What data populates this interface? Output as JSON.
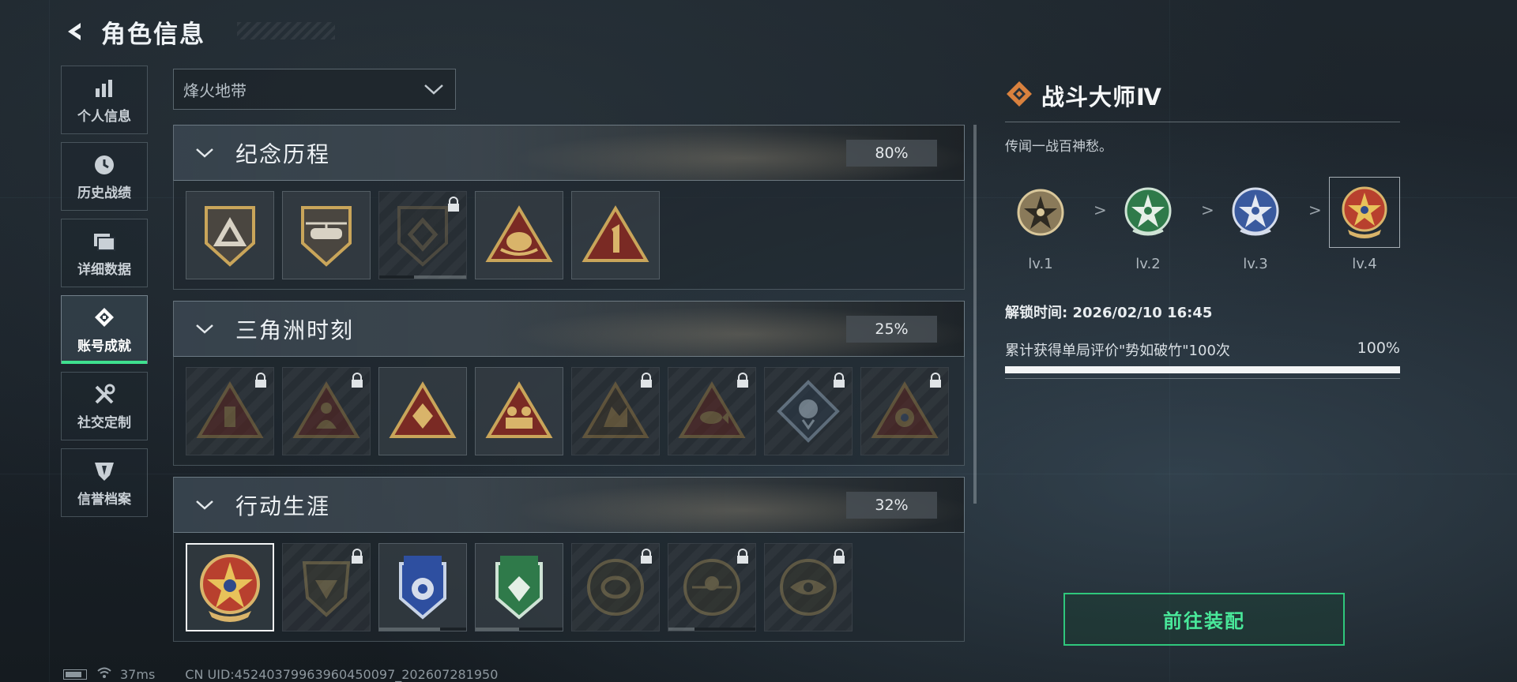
{
  "header": {
    "title": "角色信息"
  },
  "sidebar": {
    "items": [
      {
        "label": "个人信息",
        "icon": "bar-chart-icon",
        "active": false
      },
      {
        "label": "历史战绩",
        "icon": "clock-icon",
        "active": false
      },
      {
        "label": "详细数据",
        "icon": "folder-icon",
        "active": false
      },
      {
        "label": "账号成就",
        "icon": "achievement-icon",
        "active": true
      },
      {
        "label": "社交定制",
        "icon": "tools-icon",
        "active": false
      },
      {
        "label": "信誉档案",
        "icon": "shield-icon",
        "active": false
      }
    ]
  },
  "mode_select": {
    "value": "烽火地带"
  },
  "categories": [
    {
      "name": "纪念历程",
      "percent": "80%",
      "badges": [
        {
          "icon": "triangle-shield-badge",
          "locked": false
        },
        {
          "icon": "helicopter-shield-badge",
          "locked": false
        },
        {
          "icon": "emblem-shield-badge",
          "locked": true
        },
        {
          "icon": "hand-triangle-badge",
          "locked": false
        },
        {
          "icon": "number-one-triangle-badge",
          "locked": false
        }
      ]
    },
    {
      "name": "三角洲时刻",
      "percent": "25%",
      "badges": [
        {
          "icon": "bottle-triangle-badge",
          "locked": true
        },
        {
          "icon": "figure-triangle-badge",
          "locked": true
        },
        {
          "icon": "diamond-triangle-badge",
          "locked": false
        },
        {
          "icon": "squad-triangle-badge",
          "locked": false
        },
        {
          "icon": "beast-triangle-badge",
          "locked": true
        },
        {
          "icon": "fish-triangle-badge",
          "locked": true
        },
        {
          "icon": "rose-diamond-badge",
          "locked": true
        },
        {
          "icon": "orb-triangle-badge",
          "locked": true
        }
      ]
    },
    {
      "name": "行动生涯",
      "percent": "32%",
      "badges": [
        {
          "icon": "combat-master-badge",
          "locked": false,
          "selected": true
        },
        {
          "icon": "bunker-shield-badge",
          "locked": true
        },
        {
          "icon": "blue-wing-badge",
          "locked": false
        },
        {
          "icon": "green-gem-badge",
          "locked": false
        },
        {
          "icon": "ring-round-badge",
          "locked": true
        },
        {
          "icon": "crosshair-round-badge",
          "locked": true
        },
        {
          "icon": "eye-round-badge",
          "locked": true
        }
      ]
    }
  ],
  "detail": {
    "title": "战斗大师Ⅳ",
    "description": "传闻一战百神愁。",
    "levels": [
      "lv.1",
      "lv.2",
      "lv.3",
      "lv.4"
    ],
    "arrow": ">",
    "unlock_time": "解锁时间: 2026/02/10 16:45",
    "task": {
      "text": "累计获得单局评价\"势如破竹\"100次",
      "percent": "100%",
      "progress": 1.0
    },
    "equip_button": "前往装配"
  },
  "footer": {
    "ping": "37ms",
    "uid": "CN UID:452403799639604500​97_202607281950"
  },
  "colors": {
    "accent_green": "#3fe08f",
    "gold": "#c9a55a",
    "background": "#1a2128"
  }
}
